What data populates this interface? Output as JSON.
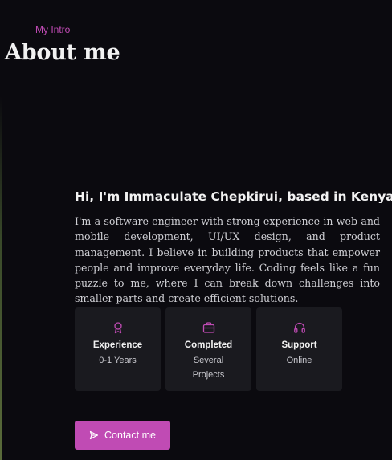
{
  "header": {
    "kicker": "My Intro",
    "title": "About me"
  },
  "intro": {
    "heading": "Hi, I'm Immaculate Chepkirui, based in Kenya",
    "text": "I'm a software engineer with strong experience in web and mobile development, UI/UX design, and product management. I believe in building products that empower people and improve everyday life. Coding feels like a fun puzzle to me, where I can break down challenges into smaller parts and create efficient solutions."
  },
  "cards": [
    {
      "icon": "award-icon",
      "title": "Experience",
      "value": "0-1 Years"
    },
    {
      "icon": "briefcase-icon",
      "title": "Completed",
      "value": "Several Projects"
    },
    {
      "icon": "headset-icon",
      "title": "Support",
      "value": "Online"
    }
  ],
  "contact_button": {
    "label": "Contact me",
    "icon": "send-icon"
  },
  "colors": {
    "accent": "#c04bb4",
    "background": "#0b0a0f",
    "card": "#1a1a1f"
  }
}
